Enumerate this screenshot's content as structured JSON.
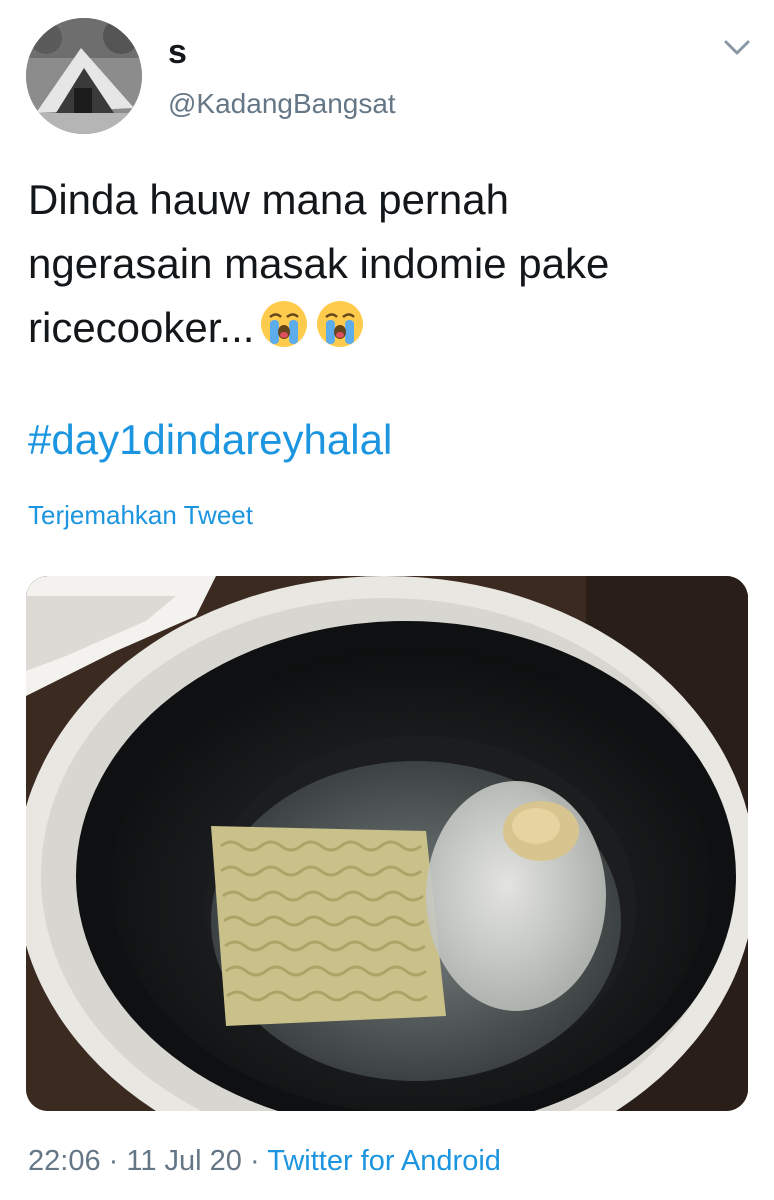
{
  "user": {
    "display_name": "s",
    "handle": "@KadangBangsat"
  },
  "tweet": {
    "lines": [
      "Dinda hauw mana pernah",
      "ngerasain masak indomie pake",
      "ricecooker..."
    ],
    "emojis": [
      "loudly-crying-face-icon",
      "loudly-crying-face-icon"
    ],
    "hashtag": "#day1dindareyhalal",
    "translate_label": "Terjemahkan Tweet"
  },
  "meta": {
    "time": "22:06",
    "separator": "·",
    "date": "11 Jul 20",
    "source": "Twitter for Android"
  },
  "colors": {
    "link": "#1b95e0",
    "secondary_text": "#657786",
    "primary_text": "#14171a"
  }
}
